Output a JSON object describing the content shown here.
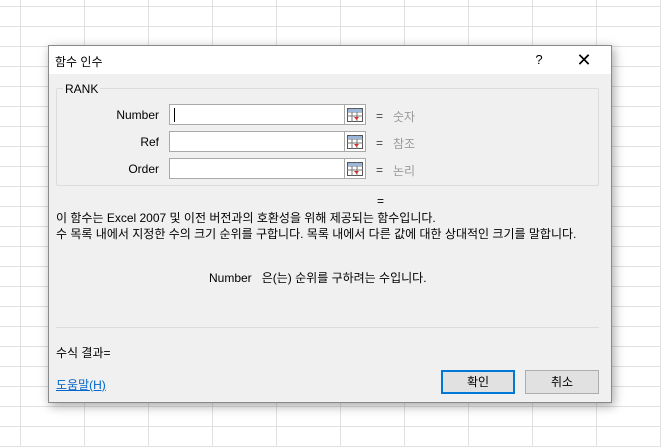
{
  "dialog": {
    "title": "함수 인수",
    "help_glyph": "?",
    "close_glyph": "✕"
  },
  "function_group": {
    "name": "RANK",
    "args": [
      {
        "label": "Number",
        "value": "",
        "hint": "숫자"
      },
      {
        "label": "Ref",
        "value": "",
        "hint": "참조"
      },
      {
        "label": "Order",
        "value": "",
        "hint": "논리"
      }
    ],
    "equals": "="
  },
  "result_equals": "=",
  "description": {
    "line1": "이 함수는 Excel 2007 및 이전 버전과의 호환성을 위해 제공되는 함수입니다.",
    "line2": "수 목록 내에서 지정한 수의 크기 순위를 구합니다. 목록 내에서 다른 값에 대한 상대적인 크기를 말합니다.",
    "arg_name": "Number",
    "arg_text": "은(는) 순위를 구하려는 수입니다."
  },
  "formula_result_label": "수식 결과=",
  "help_link": "도움말(H)",
  "buttons": {
    "ok": "확인",
    "cancel": "취소"
  },
  "colors": {
    "accent": "#0078d7",
    "link": "#0066cc",
    "hint": "#9a9a9a"
  },
  "icons": {
    "ref_button": "range-select-icon",
    "close": "close-icon"
  }
}
